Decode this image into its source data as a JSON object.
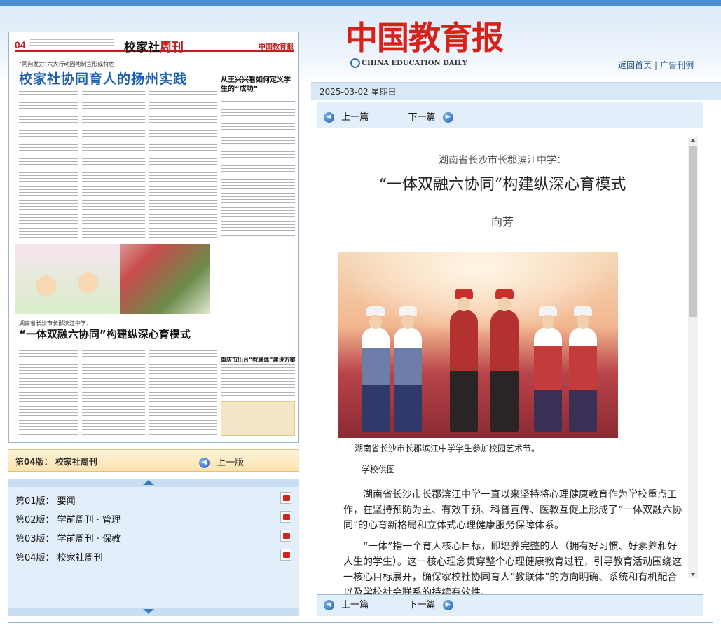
{
  "header": {
    "logo_text": "中国教育报",
    "logo_en": "CHINA EDUCATION DAILY",
    "links": [
      "返回首页",
      "广告刊例"
    ],
    "link_separator": "|",
    "date": "2025-03-02  星期日"
  },
  "newspaper": {
    "page_num": "04",
    "section_title_a": "校家社",
    "section_title_b": "周刊",
    "paper_logo": "中国教育报",
    "kicker": "“同向发力”六大行动因地制宜形成特色",
    "headline": "校家社协同育人的扬州实践",
    "side_story": "从王兴兴看如何定义学生的“成功”",
    "story2_kicker": "湖南省长沙市长郡滨江中学：",
    "story2_headline": "“一体双融六协同”构建纵深心育模式",
    "side_story2": "重庆市出台“教联体”建设方案"
  },
  "edition_bar": {
    "label": "第04版：  校家社周刊",
    "prev": "上一版"
  },
  "editions": [
    {
      "label": "第01版：  要闻"
    },
    {
      "label": "第02版：  学前周刊 · 管理"
    },
    {
      "label": "第03版：  学前周刊 · 保教"
    },
    {
      "label": "第04版：  校家社周刊"
    }
  ],
  "article_nav": {
    "prev": "上一篇",
    "next": "下一篇"
  },
  "article": {
    "pre_title": "湖南省长沙市长郡滨江中学：",
    "title": "“一体双融六协同”构建纵深心育模式",
    "author": "向芳",
    "photo_caption": "湖南省长沙市长郡滨江中学学生参加校园艺术节。",
    "photo_credit": "学校供图",
    "paragraphs": [
      "湖南省长沙市长郡滨江中学一直以来坚持将心理健康教育作为学校重点工作，在坚持预防为主、有效干预、科普宣传、医教互促上形成了“一体双融六协同”的心育新格局和立体式心理健康服务保障体系。",
      "“一体”指一个育人核心目标，即培养完整的人（拥有好习惯、好素养和好人生的学生）。这一核心理念贯穿整个心理健康教育过程，引导教育活动围绕这一核心目标展开，确保家校社协同育人“教联体”的方向明确、系统和有机配合以及学校社会联系的持续有效性。"
    ]
  },
  "colors": {
    "brand_red": "#d7221b",
    "link_blue": "#1c4f8a",
    "panel_blue": "#e2effa",
    "edition_bar": "#fde2ad"
  },
  "icons": {
    "nav_prev": "circle-left-arrow-icon",
    "nav_next": "circle-right-arrow-icon",
    "pdf": "pdf-icon"
  }
}
